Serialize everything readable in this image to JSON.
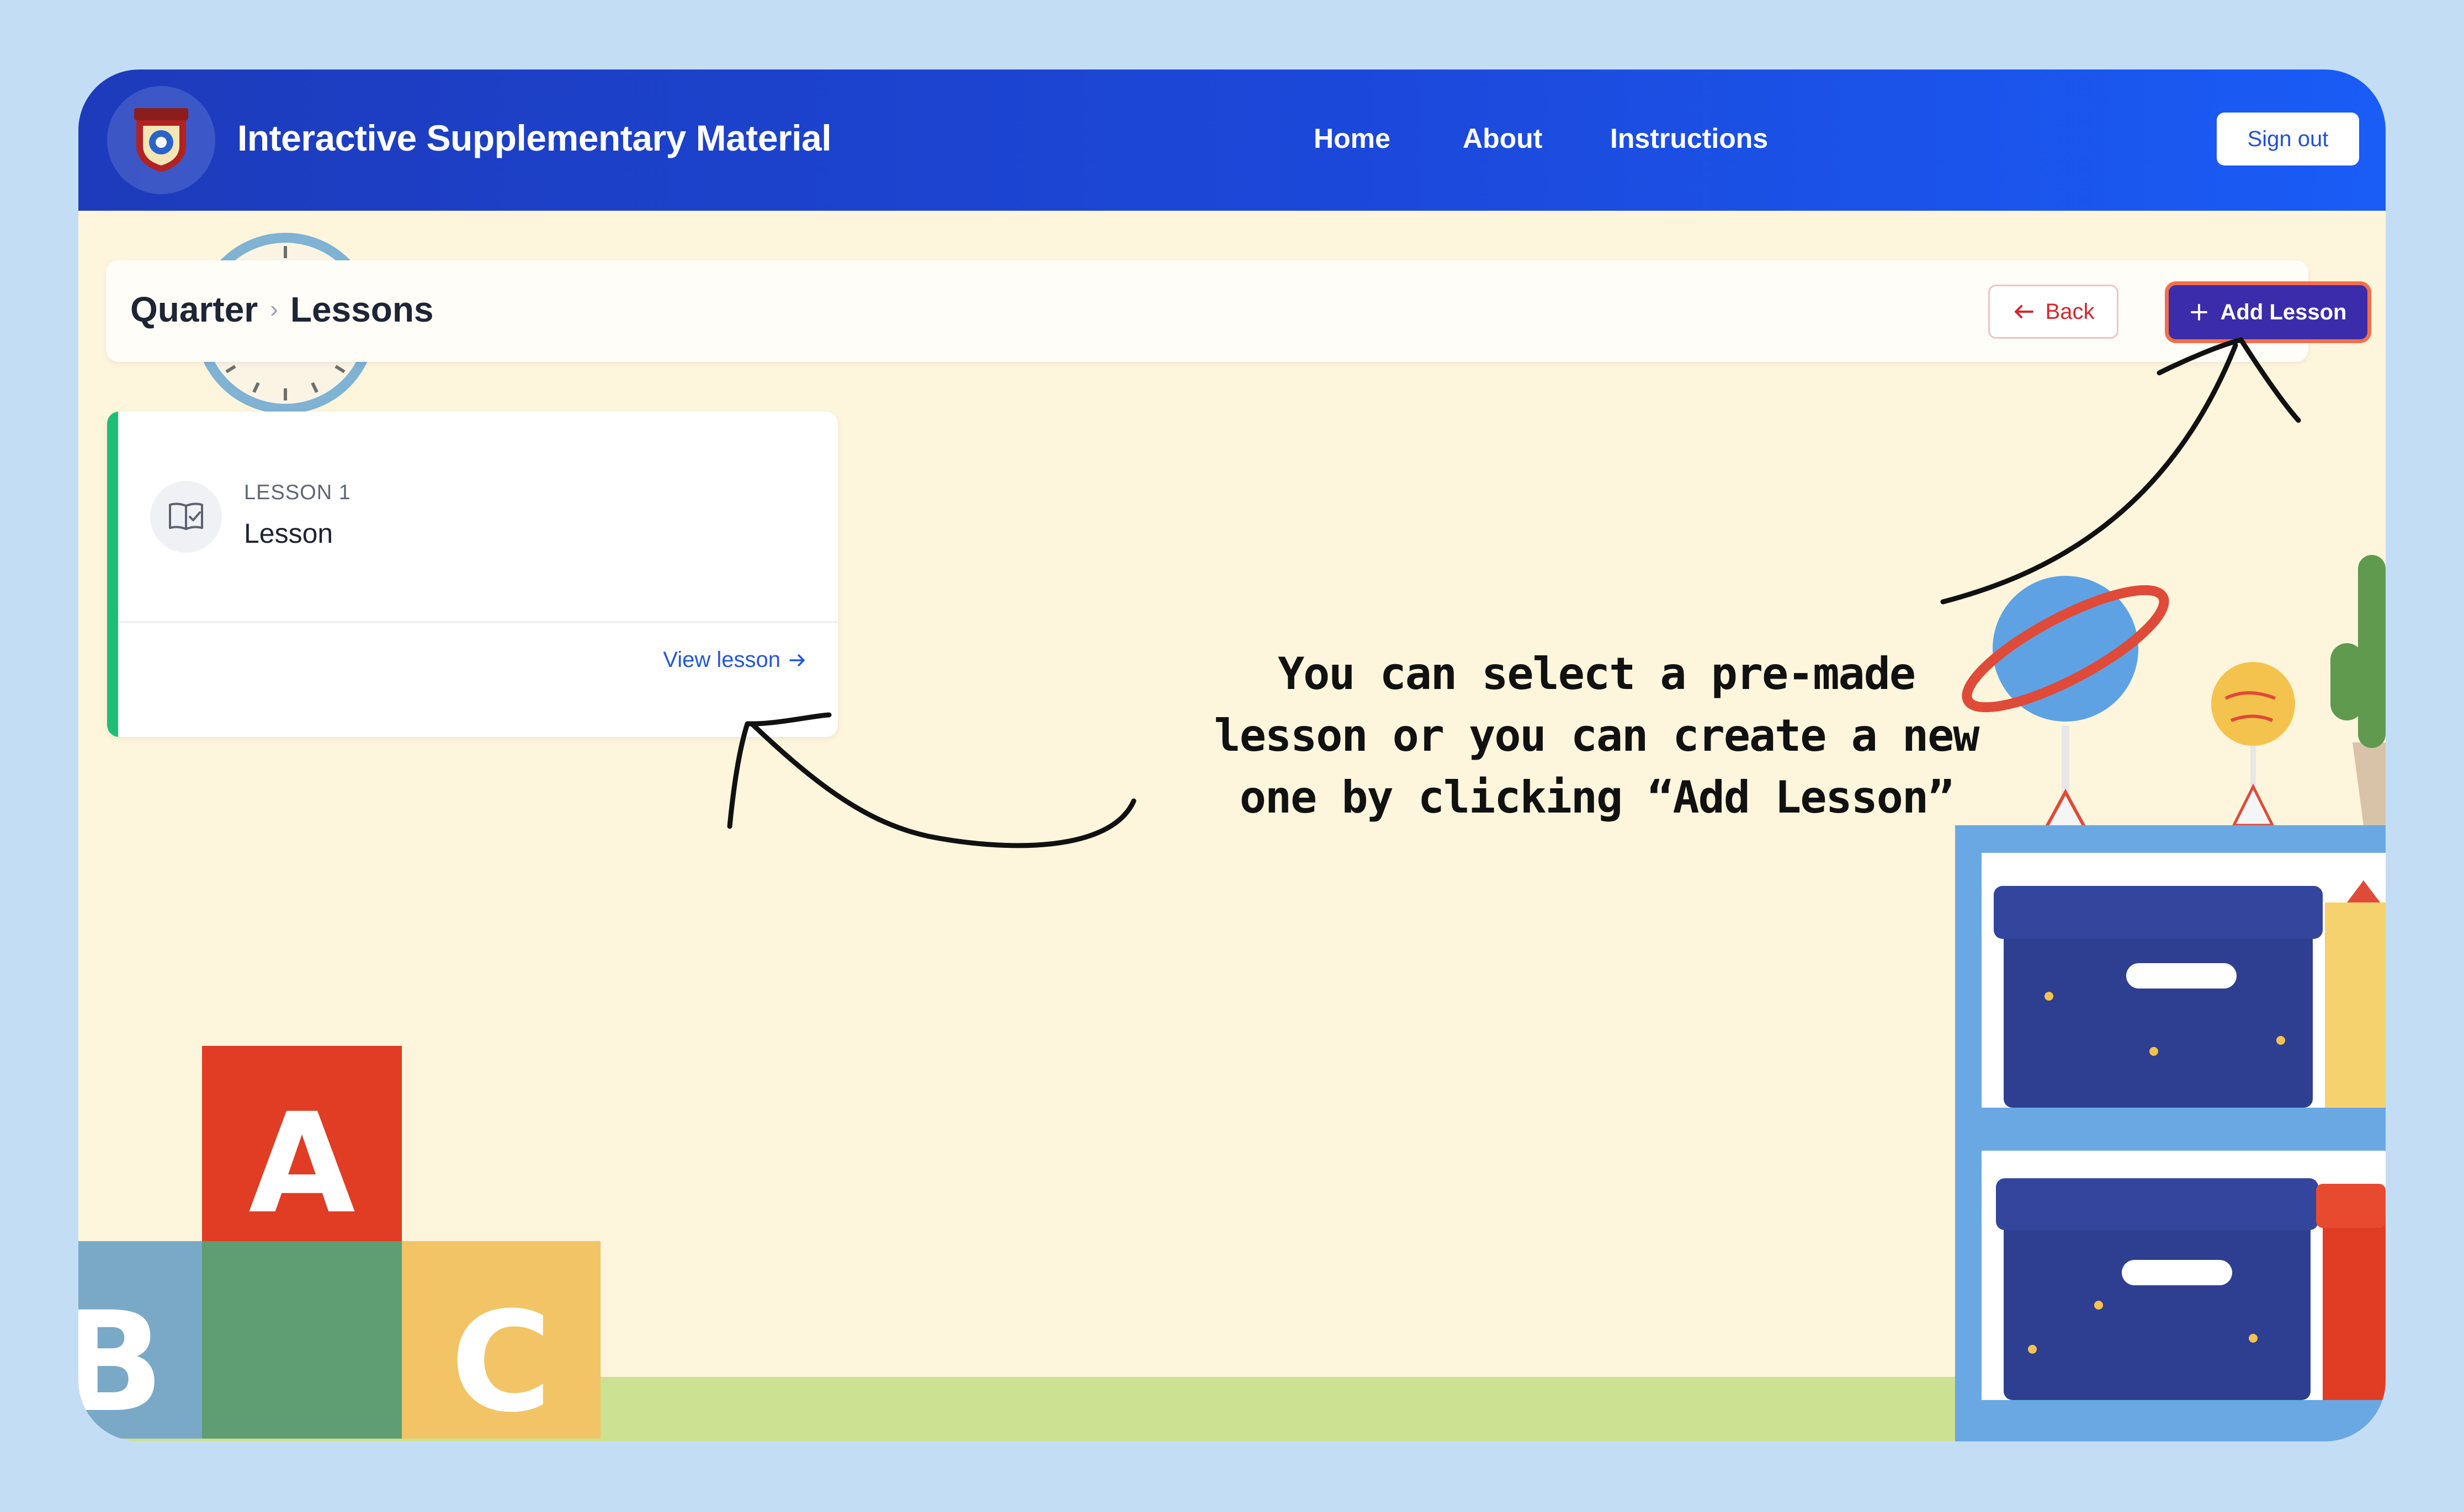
{
  "app": {
    "title": "Interactive Supplementary Material"
  },
  "nav": {
    "items": [
      {
        "label": "Home"
      },
      {
        "label": "About"
      },
      {
        "label": "Instructions"
      }
    ],
    "sign_out_label": "Sign out"
  },
  "header": {
    "breadcrumb": [
      "Quarter",
      "Lessons"
    ],
    "back_label": "Back",
    "add_label": "Add Lesson"
  },
  "lessons": [
    {
      "number": "LESSON 1",
      "title": "Lesson",
      "link_label": "View lesson"
    }
  ],
  "annotation": {
    "lines": [
      "You can select a pre-made",
      "lesson or you can create a new",
      "one by clicking “Add Lesson”"
    ]
  },
  "decor": {
    "blocks": [
      "A",
      "B",
      "C"
    ]
  },
  "colors": {
    "page_bg": "#c3def4",
    "nav_gradient_start": "#1d3bbb",
    "nav_gradient_end": "#1a5cf6",
    "content_bg": "#fdf5dc",
    "accent_green": "#1dbf73",
    "add_button": "#3a2cab",
    "add_button_outline": "#f36f4a",
    "back_text": "#d7262c",
    "link_blue": "#2558d8"
  },
  "icons": [
    "seal-logo-icon",
    "arrow-left-icon",
    "plus-icon",
    "book-check-icon",
    "arrow-right-icon"
  ]
}
